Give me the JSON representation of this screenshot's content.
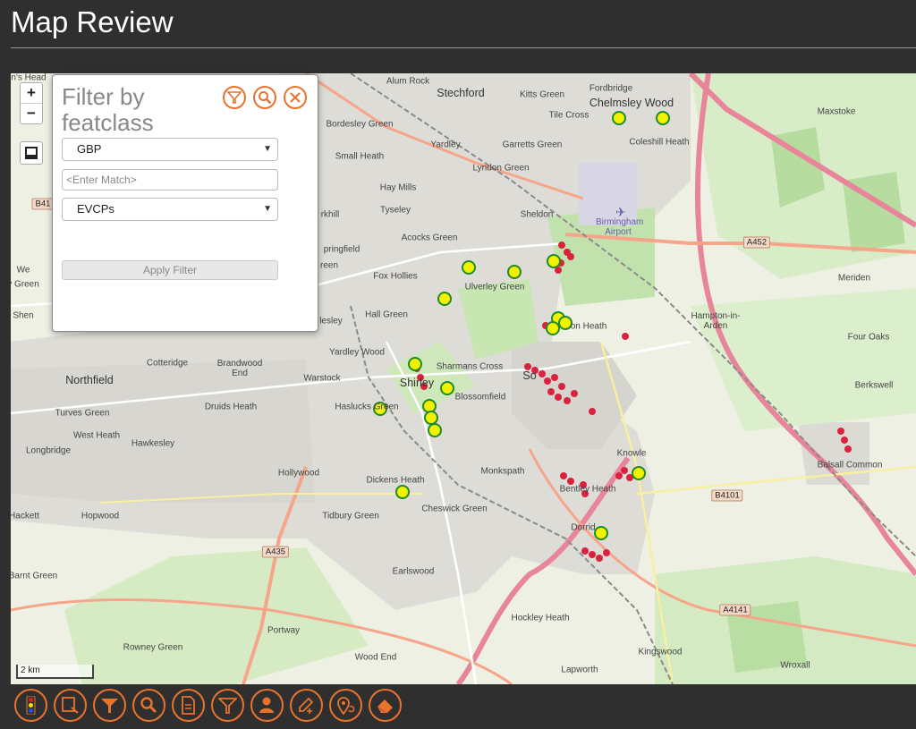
{
  "page": {
    "title": "Map Review"
  },
  "map": {
    "zoom_in": "+",
    "zoom_out": "−",
    "scale_label": "2 km",
    "places": {
      "stechford": "Stechford",
      "alum_rock": "Alum Rock",
      "kitts_green": "Kitts Green",
      "fordbridge": "Fordbridge",
      "chelmsley_wood": "Chelmsley Wood",
      "tile_cross": "Tile Cross",
      "coleshill_heath": "Coleshill Heath",
      "maxstoke": "Maxstoke",
      "bordesley_green": "Bordesley Green",
      "yardley": "Yardley",
      "garretts_green": "Garretts Green",
      "small_heath": "Small Heath",
      "lyndon_green": "Lyndon Green",
      "hay_mills": "Hay Mills",
      "tyseley": "Tyseley",
      "sheldon": "Sheldon",
      "birmingham_airport": "Birmingham Airport",
      "acocks_green": "Acocks Green",
      "sparkhill": "rkhill",
      "springfield": "pringfield",
      "fox_hollies": "Fox Hollies",
      "ulverley_green": "Ulverley Green",
      "hall_green": "Hall Green",
      "elmdon_heath": "on Heath",
      "hampton_in_arden": "Hampton-in-Arden",
      "meriden": "Meriden",
      "four_oaks": "Four Oaks",
      "yardley_wood": "Yardley Wood",
      "moseley": "lesley",
      "cotteridge": "Cotteridge",
      "brandwood_end": "Brandwood End",
      "northfield": "Northfield",
      "warstock": "Warstock",
      "shirley": "Shirley",
      "sharmans_cross": "Sharmans Cross",
      "blossomfield": "Blossomfield",
      "solihull": "So",
      "berkswell": "Berkswell",
      "turves_green": "Turves Green",
      "druids_heath": "Druids Heath",
      "hasluck_green": "Haslucks Green",
      "west_heath": "West Heath",
      "hawkesley": "Hawkesley",
      "longbridge": "Longbridge",
      "knowle": "Knowle",
      "balsall_common": "Balsall Common",
      "hollywood": "Hollywood",
      "monkspath": "Monkspath",
      "dickens_heath": "Dickens Heath",
      "bentley_heath": "Bentley Heath",
      "cheswick_green": "Cheswick Green",
      "hackett": "Hackett",
      "hopwood": "Hopwood",
      "tidbury_green": "Tidbury Green",
      "dorridge": "Dorrid",
      "barnt_green": "Barnt Green",
      "earlswood": "Earlswood",
      "portway": "Portway",
      "hockley_heath": "Hockley Heath",
      "rowney_green": "Rowney Green",
      "kingswood": "Kingswood",
      "wood_end": "Wood End",
      "lapworth": "Lapworth",
      "wroxall": "Wroxall",
      "kings_head": "n's Head",
      "green_left": "y Green",
      "shen": "Shen",
      "we": "We",
      "reen": "reen"
    },
    "roads": {
      "a452": "A452",
      "b4101": "B4101",
      "a435": "A435",
      "a4141": "A4141",
      "b41": "B41"
    },
    "colors": {
      "evcp_marker": "#f2f200",
      "evcp_ring": "#1f8a2a",
      "red_marker": "#d9223e",
      "motorway": "#e8859a",
      "trunk": "#f6a58a",
      "green_area": "#c8e6b8",
      "urban": "#dcdcd6"
    }
  },
  "filter_panel": {
    "title": "Filter by featclass",
    "dataset_select": "GBP",
    "match_placeholder": "<Enter Match>",
    "featclass_select": "EVCPs",
    "apply_label": "Apply Filter"
  },
  "toolbar": {
    "tools": [
      "layers-icon",
      "export-icon",
      "filter-solid-icon",
      "search-icon",
      "document-icon",
      "filter-outline-icon",
      "user-settings-icon",
      "edit-add-icon",
      "location-refresh-icon",
      "eraser-icon"
    ]
  }
}
